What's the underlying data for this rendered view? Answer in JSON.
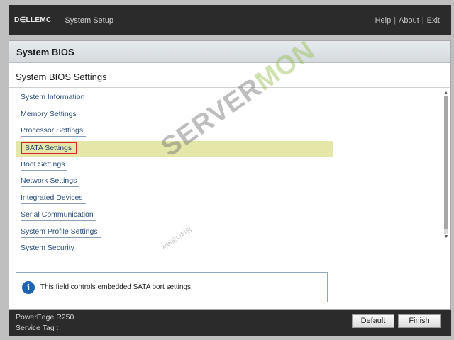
{
  "topbar": {
    "logo": "D∈LLEMC",
    "app_title": "System Setup",
    "links": [
      "Help",
      "About",
      "Exit"
    ]
  },
  "panel": {
    "title": "System BIOS",
    "subtitle": "System BIOS Settings",
    "menu_items": [
      {
        "label": "System Information"
      },
      {
        "label": "Memory Settings"
      },
      {
        "label": "Processor Settings"
      },
      {
        "label": "SATA Settings"
      },
      {
        "label": "Boot Settings"
      },
      {
        "label": "Network Settings"
      },
      {
        "label": "Integrated Devices"
      },
      {
        "label": "Serial Communication"
      },
      {
        "label": "System Profile Settings"
      },
      {
        "label": "System Security"
      }
    ],
    "selected_index": 3
  },
  "watermark": {
    "main_prefix": "SERVER",
    "main_suffix": "MON",
    "sub": "서버모니터링"
  },
  "info": {
    "icon": "info-icon",
    "text": "This field controls embedded SATA port settings."
  },
  "footer": {
    "model": "PowerEdge R250",
    "service_tag": "Service Tag :",
    "default_label": "Default",
    "finish_label": "Finish"
  },
  "colors": {
    "header_bar": "#2b2b2b",
    "highlight": "#e4e7a8",
    "selection_border": "#d8232a",
    "link": "#2a4f7c"
  }
}
